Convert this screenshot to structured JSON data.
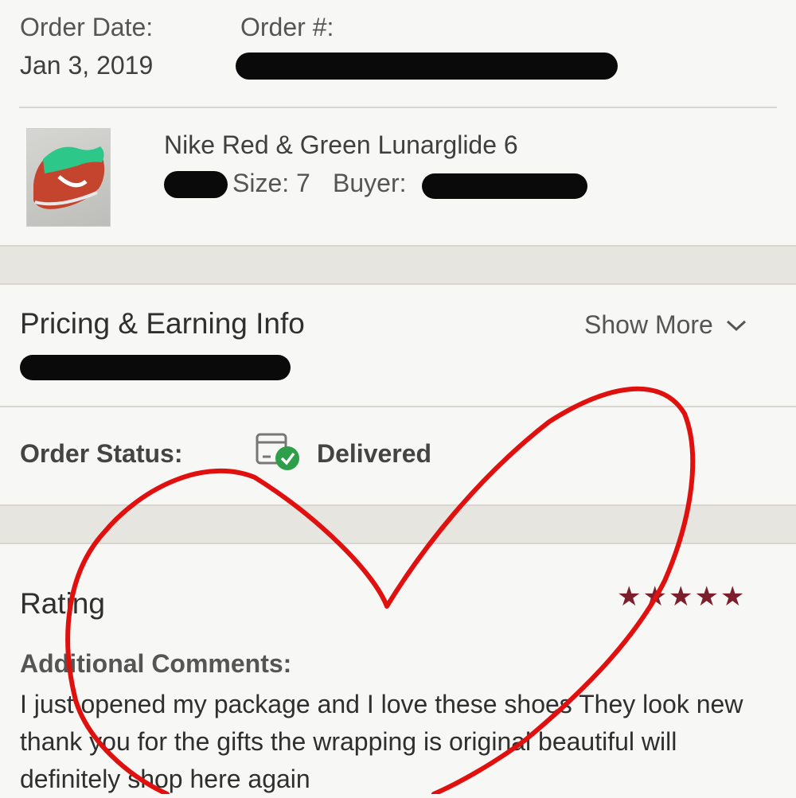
{
  "order": {
    "date_label": "Order Date:",
    "date_value": "Jan 3, 2019",
    "number_label": "Order #:"
  },
  "item": {
    "title": "Nike Red & Green Lunarglide 6",
    "size_text": "Size: 7",
    "buyer_label": "Buyer:",
    "thumbnail_icon": "sneaker-thumbnail"
  },
  "pricing": {
    "heading": "Pricing & Earning Info",
    "show_more": "Show More",
    "chevron_icon": "chevron-down-icon"
  },
  "status": {
    "label": "Order Status:",
    "value": "Delivered",
    "icon": "package-delivered-icon",
    "check_color": "#2e9e4a"
  },
  "rating": {
    "heading": "Rating",
    "stars": 5,
    "star_color": "#7a1f2b",
    "comments_label": "Additional Comments:",
    "comment": "I just opened my package and I love these shoes They look new thank you for the gifts the wrapping is original beautiful will definitely shop here again"
  },
  "annotation": {
    "shape": "hand-drawn-heart",
    "color": "#e0100f"
  }
}
